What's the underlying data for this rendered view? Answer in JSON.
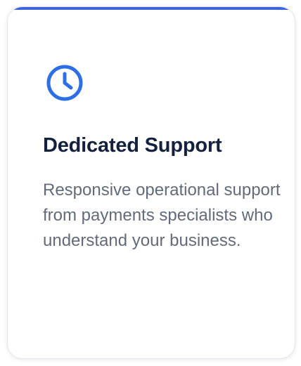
{
  "card": {
    "icon": "clock-icon",
    "title": "Dedicated Support",
    "description": "Responsive operational support from payments specialists who understand your business."
  },
  "colors": {
    "accent": "#3d63dd",
    "icon": "#2f6fe6",
    "title": "#14213d",
    "body_text": "#636b7a"
  }
}
